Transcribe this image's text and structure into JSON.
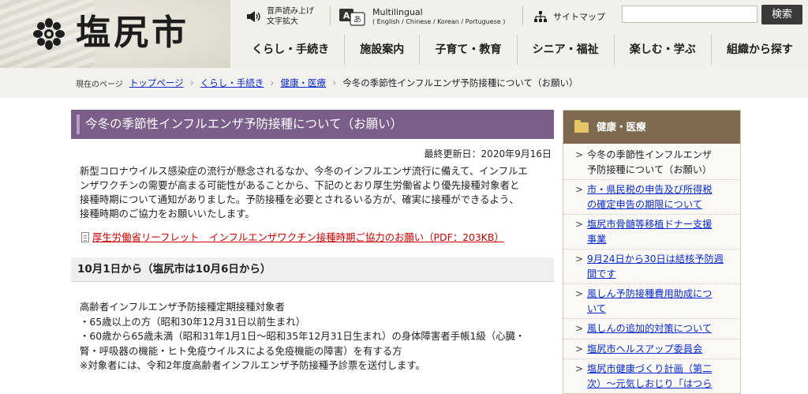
{
  "header": {
    "logo_text": "塩尻市",
    "speech": {
      "line1": "音声読み上げ",
      "line2": "文字拡大",
      "icon": "speaker-icon"
    },
    "multilingual": {
      "line1": "Multilingual",
      "line2": "( English / Chinese / Korean / Portuguese )",
      "icon": "language-icon"
    },
    "sitemap": {
      "label": "サイトマップ",
      "icon": "sitemap-icon"
    },
    "search": {
      "value": "",
      "button": "検索"
    },
    "nav": [
      "くらし・手続き",
      "施設案内",
      "子育て・教育",
      "シニア・福祉",
      "楽しむ・学ぶ",
      "組織から探す"
    ]
  },
  "breadcrumb": {
    "here_label": "現在のページ",
    "links": [
      "トップページ",
      "くらし・手続き",
      "健康・医療"
    ],
    "current": "今冬の季節性インフルエンザ予防接種について（お願い）"
  },
  "main": {
    "title": "今冬の季節性インフルエンザ予防接種について（お願い）",
    "updated": "最終更新日：2020年9月16日",
    "lead": [
      "新型コロナウイルス感染症の流行が懸念されるなか、今冬のインフルエンザ流行に備えて、インフルエ",
      "ンザワクチンの需要が高まる可能性があることから、下記のとおり厚生労働省より優先接種対象者と",
      "接種時期について通知がありました。予防接種を必要とされるいる方が、確実に接種ができるよう、",
      "接種時期のご協力をお願いいたします。"
    ],
    "pdf_link": "厚生労働省リーフレット　インフルエンザワクチン接種時期ご協力のお願い（PDF：203KB）",
    "section_heading": "10月1日から（塩尻市は10月6日から）",
    "section_body": [
      "高齢者インフルエンザ予防接種定期接種対象者",
      "・65歳以上の方（昭和30年12月31日以前生まれ）",
      "・60歳から65歳未満（昭和31年1月1日～昭和35年12月31日生まれ）の身体障害者手帳1級（心臓・",
      "腎・呼吸器の機能・ヒト免疫ウイルスによる免疫機能の障害）を有する方",
      "※対象者には、令和2年度高齢者インフルエンザ予防接種予診票を送付します。"
    ]
  },
  "sidebar": {
    "heading": "健康・医療",
    "items": [
      {
        "lines": [
          "今冬の季節性インフルエンザ",
          "予防接種について（お願い）"
        ],
        "current": true
      },
      {
        "lines": [
          "市・県民税の申告及び所得税",
          "の確定申告の期限について"
        ],
        "current": false
      },
      {
        "lines": [
          "塩尻市骨髄等移植ドナー支援",
          "事業"
        ],
        "current": false
      },
      {
        "lines": [
          "9月24日から30日は結核予防週",
          "間です"
        ],
        "current": false
      },
      {
        "lines": [
          "風しん予防接種費用助成につ",
          "いて"
        ],
        "current": false
      },
      {
        "lines": [
          "風しんの追加的対策について"
        ],
        "current": false
      },
      {
        "lines": [
          "塩尻市ヘルスアップ委員会"
        ],
        "current": false
      },
      {
        "lines": [
          "塩尻市健康づくり計画（第二",
          "次）～元気しおじり「はつら"
        ],
        "current": false
      }
    ]
  }
}
